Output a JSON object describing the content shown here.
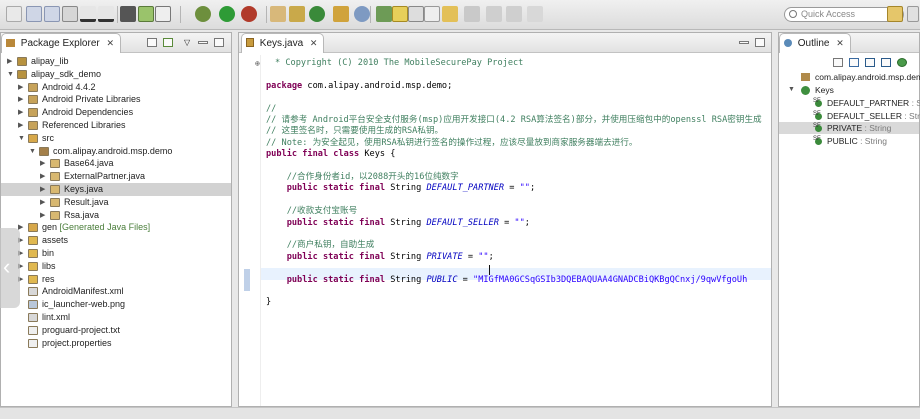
{
  "toolbar": {
    "quick_access_placeholder": "Quick Access",
    "icons": [
      "new-icon",
      "save-icon",
      "print-icon",
      "debug-icon",
      "run-icon",
      "external-tools-icon",
      "new-class-icon",
      "open-type-icon",
      "search-icon",
      "toggle-mark-icon",
      "next-annotation-icon",
      "back-icon",
      "forward-icon"
    ]
  },
  "package_explorer": {
    "title": "Package Explorer",
    "items": [
      {
        "label": "alipay_lib",
        "depth": 0,
        "expanded": false,
        "icon": "project-icon"
      },
      {
        "label": "alipay_sdk_demo",
        "depth": 0,
        "expanded": true,
        "icon": "project-icon"
      },
      {
        "label": "Android 4.4.2",
        "depth": 1,
        "expanded": false,
        "icon": "library-icon"
      },
      {
        "label": "Android Private Libraries",
        "depth": 1,
        "expanded": false,
        "icon": "library-icon"
      },
      {
        "label": "Android Dependencies",
        "depth": 1,
        "expanded": false,
        "icon": "library-icon"
      },
      {
        "label": "Referenced Libraries",
        "depth": 1,
        "expanded": false,
        "icon": "library-icon"
      },
      {
        "label": "src",
        "depth": 1,
        "expanded": true,
        "icon": "source-folder-icon"
      },
      {
        "label": "com.alipay.android.msp.demo",
        "depth": 2,
        "expanded": true,
        "icon": "package-icon"
      },
      {
        "label": "Base64.java",
        "depth": 3,
        "expanded": false,
        "icon": "java-file-icon"
      },
      {
        "label": "ExternalPartner.java",
        "depth": 3,
        "expanded": false,
        "icon": "java-file-icon"
      },
      {
        "label": "Keys.java",
        "depth": 3,
        "expanded": false,
        "icon": "java-file-icon",
        "selected": true
      },
      {
        "label": "Result.java",
        "depth": 3,
        "expanded": false,
        "icon": "java-file-icon"
      },
      {
        "label": "Rsa.java",
        "depth": 3,
        "expanded": false,
        "icon": "java-file-icon"
      },
      {
        "label": "gen",
        "note": "[Generated Java Files]",
        "depth": 1,
        "expanded": false,
        "icon": "source-folder-icon"
      },
      {
        "label": "assets",
        "depth": 1,
        "expanded": false,
        "icon": "folder-icon"
      },
      {
        "label": "bin",
        "depth": 1,
        "expanded": false,
        "icon": "folder-icon"
      },
      {
        "label": "libs",
        "depth": 1,
        "expanded": false,
        "icon": "folder-icon"
      },
      {
        "label": "res",
        "depth": 1,
        "expanded": false,
        "icon": "folder-icon"
      },
      {
        "label": "AndroidManifest.xml",
        "depth": 1,
        "leaf": true,
        "icon": "xml-file-icon"
      },
      {
        "label": "ic_launcher-web.png",
        "depth": 1,
        "leaf": true,
        "icon": "image-file-icon"
      },
      {
        "label": "lint.xml",
        "depth": 1,
        "leaf": true,
        "icon": "xml-file-icon"
      },
      {
        "label": "proguard-project.txt",
        "depth": 1,
        "leaf": true,
        "icon": "text-file-icon"
      },
      {
        "label": "project.properties",
        "depth": 1,
        "leaf": true,
        "icon": "text-file-icon"
      }
    ]
  },
  "editor": {
    "tab_label": "Keys.java",
    "lines": [
      {
        "parts": [
          {
            "t": "* Copyright (C) 2010 The MobileSecurePay Project",
            "c": "cm"
          }
        ],
        "fold": true
      },
      {
        "parts": []
      },
      {
        "parts": [
          {
            "t": "package",
            "c": "kw"
          },
          {
            "t": " com.alipay.android.msp.demo;",
            "c": "pl"
          }
        ]
      },
      {
        "parts": []
      },
      {
        "parts": [
          {
            "t": "//",
            "c": "cm"
          }
        ]
      },
      {
        "parts": [
          {
            "t": "// 请参考 Android平台安全支付服务(msp)应用开发接口(4.2 RSA算法签名)部分，并使用压缩包中的openssl RSA密钥生成",
            "c": "cm"
          }
        ]
      },
      {
        "parts": [
          {
            "t": "// 这里签名时，只需要使用生成的RSA私钥。",
            "c": "cm"
          }
        ]
      },
      {
        "parts": [
          {
            "t": "// Note: 为安全起见，使用RSA私钥进行签名的操作过程，应该尽量放到商家服务器端去进行。",
            "c": "cm"
          }
        ]
      },
      {
        "parts": [
          {
            "t": "public",
            "c": "kw"
          },
          {
            "t": " ",
            "c": "pl"
          },
          {
            "t": "final",
            "c": "kw"
          },
          {
            "t": " ",
            "c": "pl"
          },
          {
            "t": "class",
            "c": "kw"
          },
          {
            "t": " Keys {",
            "c": "pl"
          }
        ]
      },
      {
        "parts": []
      },
      {
        "parts": [
          {
            "t": "    //合作身份者id，以2088开头的16位纯数字",
            "c": "cm"
          }
        ]
      },
      {
        "parts": [
          {
            "t": "    ",
            "c": "pl"
          },
          {
            "t": "public",
            "c": "kw"
          },
          {
            "t": " ",
            "c": "pl"
          },
          {
            "t": "static",
            "c": "kw"
          },
          {
            "t": " ",
            "c": "pl"
          },
          {
            "t": "final",
            "c": "kw"
          },
          {
            "t": " String ",
            "c": "pl"
          },
          {
            "t": "DEFAULT_PARTNER",
            "c": "it"
          },
          {
            "t": " = ",
            "c": "pl"
          },
          {
            "t": "\"\"",
            "c": "st"
          },
          {
            "t": ";",
            "c": "pl"
          }
        ]
      },
      {
        "parts": []
      },
      {
        "parts": [
          {
            "t": "    //收款支付宝账号",
            "c": "cm"
          }
        ]
      },
      {
        "parts": [
          {
            "t": "    ",
            "c": "pl"
          },
          {
            "t": "public",
            "c": "kw"
          },
          {
            "t": " ",
            "c": "pl"
          },
          {
            "t": "static",
            "c": "kw"
          },
          {
            "t": " ",
            "c": "pl"
          },
          {
            "t": "final",
            "c": "kw"
          },
          {
            "t": " String ",
            "c": "pl"
          },
          {
            "t": "DEFAULT_SELLER",
            "c": "it"
          },
          {
            "t": " = ",
            "c": "pl"
          },
          {
            "t": "\"\"",
            "c": "st"
          },
          {
            "t": ";",
            "c": "pl"
          }
        ]
      },
      {
        "parts": []
      },
      {
        "parts": [
          {
            "t": "    //商户私钥，自助生成",
            "c": "cm"
          }
        ]
      },
      {
        "parts": [
          {
            "t": "    ",
            "c": "pl"
          },
          {
            "t": "public",
            "c": "kw"
          },
          {
            "t": " ",
            "c": "pl"
          },
          {
            "t": "static",
            "c": "kw"
          },
          {
            "t": " ",
            "c": "pl"
          },
          {
            "t": "final",
            "c": "kw"
          },
          {
            "t": " String ",
            "c": "pl"
          },
          {
            "t": "PRIVATE",
            "c": "it"
          },
          {
            "t": " = ",
            "c": "pl"
          },
          {
            "t": "\"\"",
            "c": "st"
          },
          {
            "t": ";",
            "c": "pl"
          }
        ]
      },
      {
        "parts": []
      },
      {
        "parts": [
          {
            "t": "    ",
            "c": "pl"
          },
          {
            "t": "public",
            "c": "kw"
          },
          {
            "t": " ",
            "c": "pl"
          },
          {
            "t": "static",
            "c": "kw"
          },
          {
            "t": " ",
            "c": "pl"
          },
          {
            "t": "final",
            "c": "kw"
          },
          {
            "t": " String ",
            "c": "pl"
          },
          {
            "t": "PUBLIC",
            "c": "it"
          },
          {
            "t": " = ",
            "c": "pl"
          },
          {
            "t": "\"MIGfMA0GCSqGSIb3DQEBAQUAA4GNADCBiQKBgQCnxj/9qwVfgoUh",
            "c": "st"
          }
        ]
      },
      {
        "parts": []
      },
      {
        "parts": [
          {
            "t": "}",
            "c": "pl"
          }
        ]
      }
    ]
  },
  "outline": {
    "title": "Outline",
    "package": "com.alipay.android.msp.demo",
    "class_name": "Keys",
    "fields": [
      {
        "name": "DEFAULT_PARTNER",
        "type": ": String"
      },
      {
        "name": "DEFAULT_SELLER",
        "type": ": String"
      },
      {
        "name": "PRIVATE",
        "type": ": String",
        "selected": true
      },
      {
        "name": "PUBLIC",
        "type": ": String"
      }
    ]
  },
  "colors": {
    "keyword": "#7f0055",
    "comment": "#3f7f5f",
    "string": "#2a00ff",
    "field": "#0000c0",
    "selection": "#d2d2d2",
    "current_line": "#e8f2fe"
  }
}
